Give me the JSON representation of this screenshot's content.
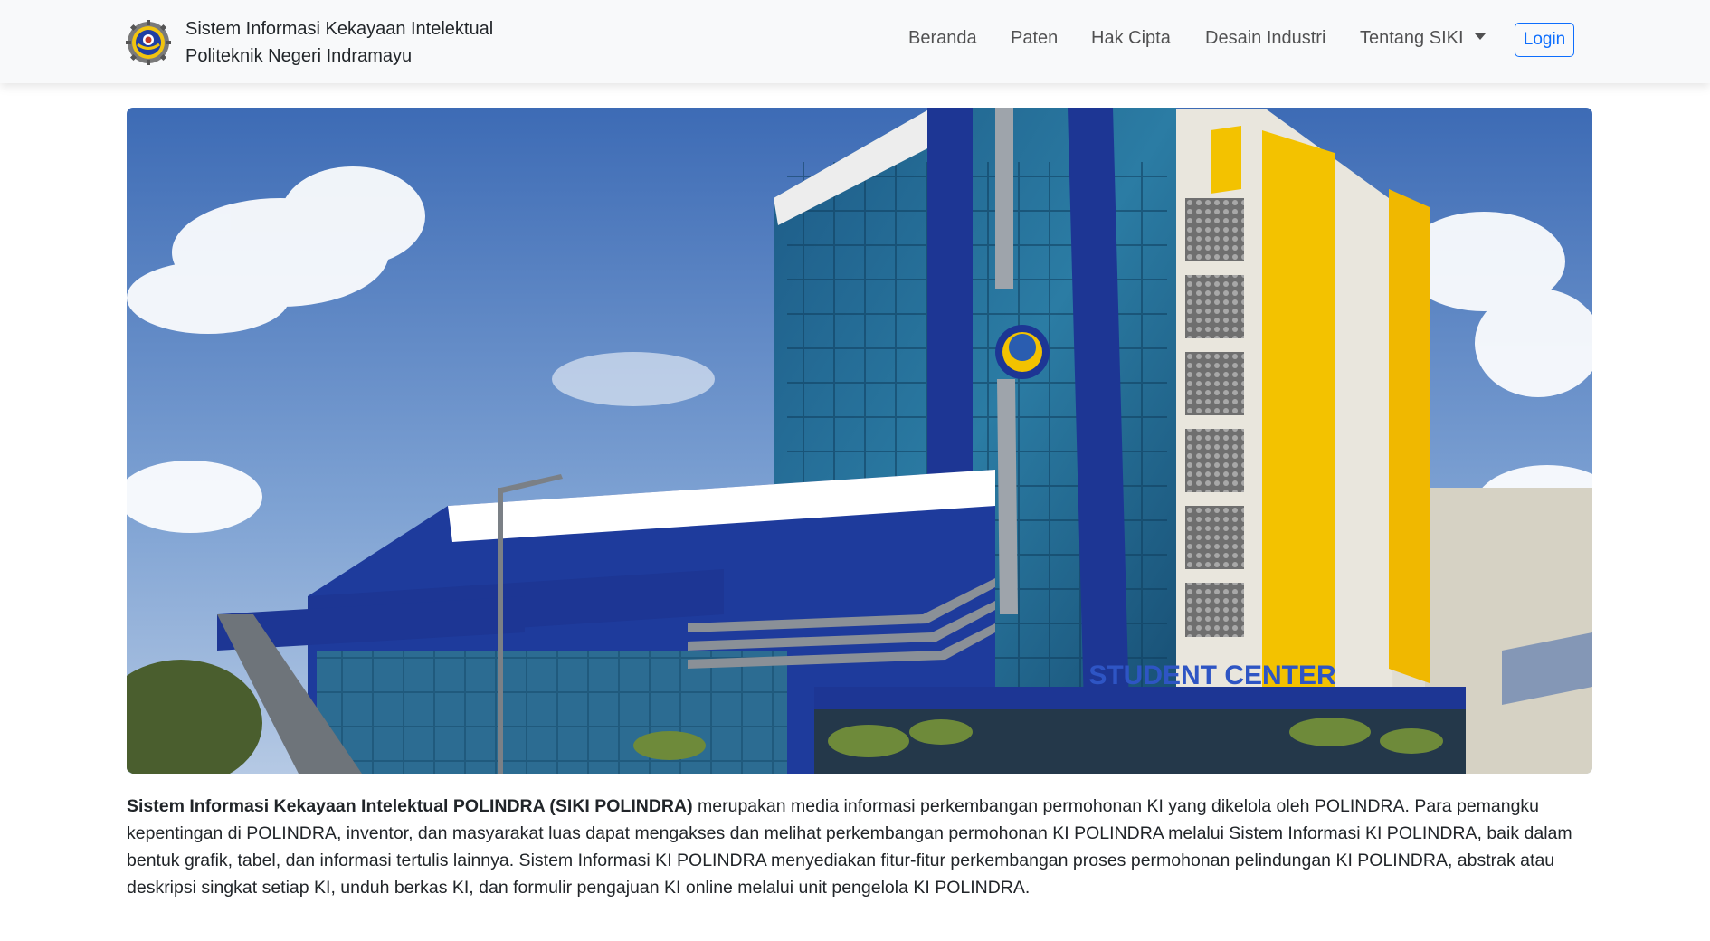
{
  "brand": {
    "line1": "Sistem Informasi Kekayaan Intelektual",
    "line2": "Politeknik Negeri Indramayu"
  },
  "nav": {
    "items": [
      {
        "label": "Beranda"
      },
      {
        "label": "Paten"
      },
      {
        "label": "Hak Cipta"
      },
      {
        "label": "Desain Industri"
      },
      {
        "label": "Tentang SIKI"
      }
    ],
    "login_label": "Login"
  },
  "hero": {
    "building_sign": "STUDENT CENTER"
  },
  "description": {
    "bold": "Sistem Informasi Kekayaan Intelektual POLINDRA (SIKI POLINDRA)",
    "text": " merupakan media informasi perkembangan permohonan KI yang dikelola oleh POLINDRA. Para pemangku kepentingan di POLINDRA, inventor, dan masyarakat luas dapat mengakses dan melihat perkembangan permohonan KI POLINDRA melalui Sistem Informasi KI POLINDRA, baik dalam bentuk grafik, tabel, dan informasi tertulis lainnya. Sistem Informasi KI POLINDRA menyediakan fitur-fitur perkembangan proses permohonan pelindungan KI POLINDRA, abstrak atau deskripsi singkat setiap KI, unduh berkas KI, dan formulir pengajuan KI online melalui unit pengelola KI POLINDRA."
  },
  "colors": {
    "navbar_bg": "#f8f9fa",
    "accent": "#0d6efd",
    "building_blue": "#1d3694",
    "building_yellow": "#f3c200"
  }
}
